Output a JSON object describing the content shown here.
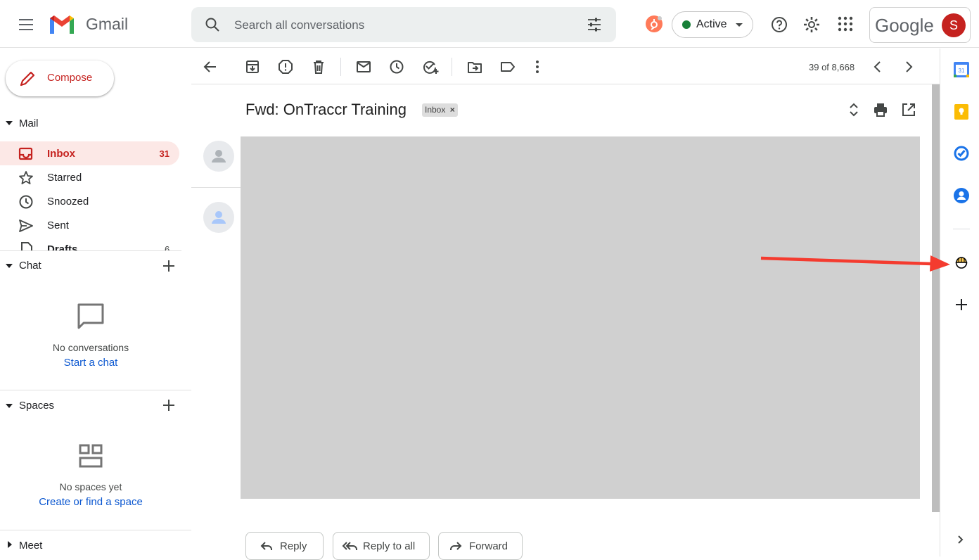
{
  "header": {
    "app_name": "Gmail",
    "search_placeholder": "Search all conversations",
    "status_label": "Active",
    "google_word": "Google",
    "avatar_initial": "S"
  },
  "sidebar": {
    "compose_label": "Compose",
    "mail_header": "Mail",
    "items": [
      {
        "label": "Inbox",
        "count": "31"
      },
      {
        "label": "Starred",
        "count": ""
      },
      {
        "label": "Snoozed",
        "count": ""
      },
      {
        "label": "Sent",
        "count": ""
      },
      {
        "label": "Drafts",
        "count": "6"
      }
    ],
    "chat_header": "Chat",
    "chat_empty": "No conversations",
    "chat_link": "Start a chat",
    "spaces_header": "Spaces",
    "spaces_empty": "No spaces yet",
    "spaces_link": "Create or find a space",
    "meet_header": "Meet"
  },
  "toolbar": {
    "pager": "39 of 8,668"
  },
  "message": {
    "subject": "Fwd: OnTraccr Training",
    "label_tag": "Inbox",
    "reply_label": "Reply",
    "reply_all_label": "Reply to all",
    "forward_label": "Forward"
  },
  "colors": {
    "accent_red": "#c5221f",
    "active_green": "#188038",
    "link_blue": "#0b57d0",
    "annotation_arrow": "#f43b2f"
  }
}
